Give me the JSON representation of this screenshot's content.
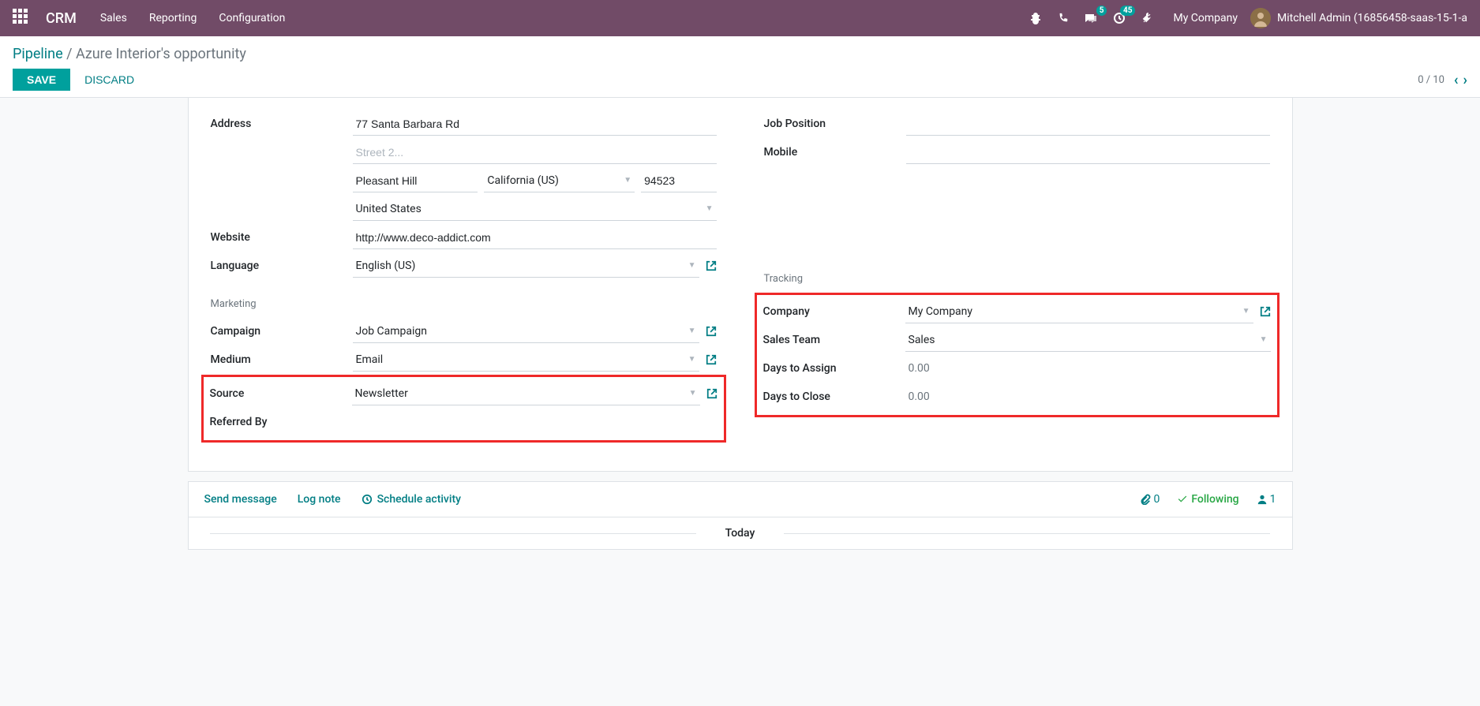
{
  "navbar": {
    "brand": "CRM",
    "links": [
      "Sales",
      "Reporting",
      "Configuration"
    ],
    "msg_badge": "5",
    "activity_badge": "45",
    "company": "My Company",
    "user": "Mitchell Admin (16856458-saas-15-1-a"
  },
  "breadcrumb": {
    "parent": "Pipeline",
    "separator": " / ",
    "current": "Azure Interior's opportunity"
  },
  "controls": {
    "save": "SAVE",
    "discard": "DISCARD",
    "pager": "0 / 10"
  },
  "form": {
    "left": {
      "address_label": "Address",
      "street": "77 Santa Barbara Rd",
      "street2_placeholder": "Street 2...",
      "city": "Pleasant Hill",
      "state": "California (US)",
      "zip": "94523",
      "country": "United States",
      "website_label": "Website",
      "website": "http://www.deco-addict.com",
      "language_label": "Language",
      "language": "English (US)",
      "marketing_title": "Marketing",
      "campaign_label": "Campaign",
      "campaign": "Job Campaign",
      "medium_label": "Medium",
      "medium": "Email",
      "source_label": "Source",
      "source": "Newsletter",
      "referred_label": "Referred By",
      "referred": ""
    },
    "right": {
      "job_label": "Job Position",
      "job": "",
      "mobile_label": "Mobile",
      "mobile": "",
      "tracking_title": "Tracking",
      "company_label": "Company",
      "company": "My Company",
      "team_label": "Sales Team",
      "team": "Sales",
      "days_assign_label": "Days to Assign",
      "days_assign": "0.00",
      "days_close_label": "Days to Close",
      "days_close": "0.00"
    }
  },
  "chatter": {
    "send": "Send message",
    "log": "Log note",
    "schedule": "Schedule activity",
    "attach_count": "0",
    "following": "Following",
    "followers": "1",
    "today": "Today"
  }
}
